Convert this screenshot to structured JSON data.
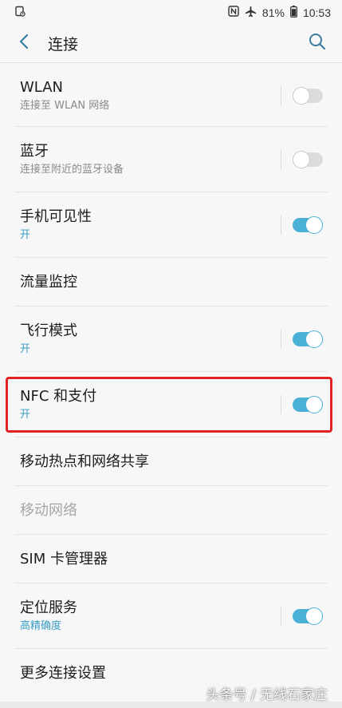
{
  "status_bar": {
    "battery_text": "81%",
    "time": "10:53",
    "icons": [
      "sim-icon",
      "nfc-icon",
      "airplane-icon",
      "battery-icon"
    ]
  },
  "app_bar": {
    "title": "连接",
    "back_icon": "back-arrow-icon",
    "search_icon": "search-icon"
  },
  "settings": {
    "wlan": {
      "title": "WLAN",
      "subtitle": "连接至 WLAN 网络",
      "toggle_on": false
    },
    "bluetooth": {
      "title": "蓝牙",
      "subtitle": "连接至附近的蓝牙设备",
      "toggle_on": false
    },
    "visibility": {
      "title": "手机可见性",
      "subtitle": "开",
      "toggle_on": true
    },
    "data_usage": {
      "title": "流量监控"
    },
    "airplane": {
      "title": "飞行模式",
      "subtitle": "开",
      "toggle_on": true
    },
    "nfc": {
      "title": "NFC 和支付",
      "subtitle": "开",
      "toggle_on": true
    },
    "hotspot": {
      "title": "移动热点和网络共享"
    },
    "mobile_networks": {
      "title": "移动网络",
      "disabled": true
    },
    "sim_manager": {
      "title": "SIM 卡管理器"
    },
    "location": {
      "title": "定位服务",
      "subtitle": "高精确度",
      "toggle_on": true
    },
    "more": {
      "title": "更多连接设置"
    }
  },
  "colors": {
    "accent": "#4bb0d6",
    "highlight": "#e02424"
  },
  "watermark": "头条号 / 无线石家庄"
}
